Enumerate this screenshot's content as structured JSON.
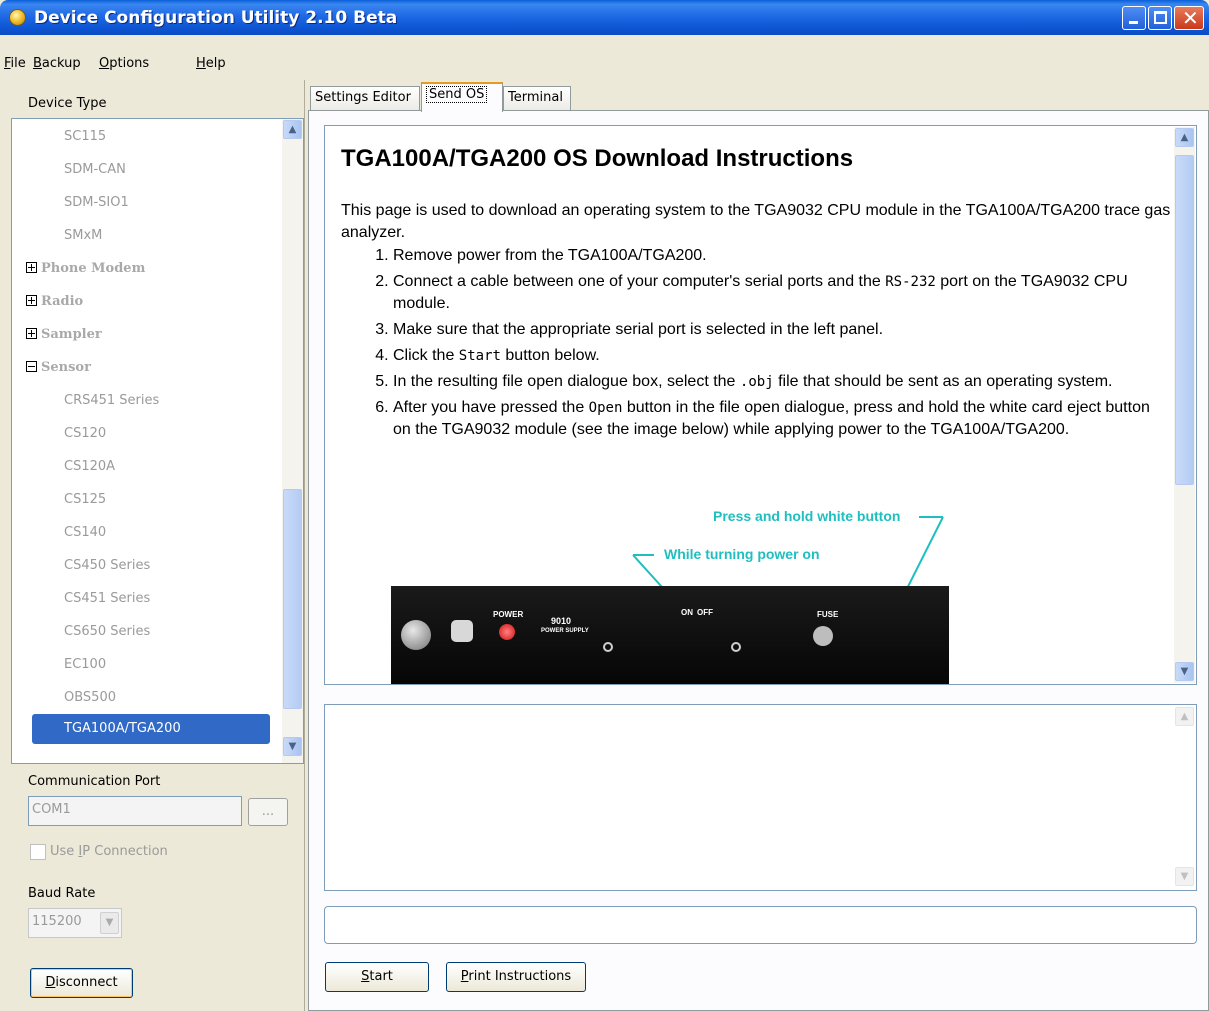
{
  "window": {
    "title": "Device Configuration Utility 2.10 Beta"
  },
  "menu": [
    "File",
    "Backup",
    "Options",
    "Help"
  ],
  "left_panel": {
    "device_type_label": "Device Type",
    "tree": [
      {
        "label": "SC115",
        "type": "leaf"
      },
      {
        "label": "SDM-CAN",
        "type": "leaf"
      },
      {
        "label": "SDM-SIO1",
        "type": "leaf"
      },
      {
        "label": "SMxM",
        "type": "leaf"
      },
      {
        "label": "Phone Modem",
        "type": "group",
        "expanded": false
      },
      {
        "label": "Radio",
        "type": "group",
        "expanded": false
      },
      {
        "label": "Sampler",
        "type": "group",
        "expanded": false
      },
      {
        "label": "Sensor",
        "type": "group",
        "expanded": true
      },
      {
        "label": "CRS451 Series",
        "type": "leaf"
      },
      {
        "label": "CS120",
        "type": "leaf"
      },
      {
        "label": "CS120A",
        "type": "leaf"
      },
      {
        "label": "CS125",
        "type": "leaf"
      },
      {
        "label": "CS140",
        "type": "leaf"
      },
      {
        "label": "CS450 Series",
        "type": "leaf"
      },
      {
        "label": "CS451 Series",
        "type": "leaf"
      },
      {
        "label": "CS650 Series",
        "type": "leaf"
      },
      {
        "label": "EC100",
        "type": "leaf"
      },
      {
        "label": "OBS500",
        "type": "leaf"
      },
      {
        "label": "TGA100A/TGA200",
        "type": "leaf",
        "selected": true
      }
    ],
    "comm_port_label": "Communication Port",
    "comm_port_value": "COM1",
    "browse_label": "...",
    "use_ip_label": "Use IP Connection",
    "use_ip_checked": false,
    "baud_rate_label": "Baud Rate",
    "baud_rate_value": "115200",
    "disconnect_label": "Disconnect"
  },
  "tabs": [
    {
      "label": "Settings Editor",
      "active": false
    },
    {
      "label": "Send OS",
      "active": true
    },
    {
      "label": "Terminal",
      "active": false
    }
  ],
  "instructions": {
    "title": "TGA100A/TGA200 OS Download Instructions",
    "intro": "This page is used to download an operating system to the TGA9032 CPU module in the TGA100A/TGA200 trace gas analyzer.",
    "steps": [
      {
        "pre": "Remove power from the TGA100A/TGA200.",
        "code": "",
        "post": ""
      },
      {
        "pre": "Connect a cable between one of your computer's serial ports and the ",
        "code": "RS-232",
        "post": " port on the TGA9032 CPU module."
      },
      {
        "pre": "Make sure that the appropriate serial port is selected in the left panel.",
        "code": "",
        "post": ""
      },
      {
        "pre": "Click the ",
        "code": "Start",
        "post": " button below."
      },
      {
        "pre": "In the resulting file open dialogue box, select the ",
        "code": ".obj",
        "post": " file that should be sent as an operating system."
      },
      {
        "pre": "After you have pressed the ",
        "code": "Open",
        "post": " button in the file open dialogue, press and hold the white card eject button on the TGA9032 module (see the image below) while applying power to the TGA100A/TGA200."
      }
    ],
    "figure": {
      "callout_1": "Press and hold white button",
      "callout_2": "While turning power on",
      "panel_power": "POWER",
      "panel_model": "9010",
      "panel_supply": "POWER SUPPLY",
      "panel_on": "ON",
      "panel_off": "OFF",
      "panel_fuse": "FUSE",
      "accent_color": "#1fbfc0"
    }
  },
  "buttons": {
    "start": "Start",
    "print": "Print Instructions"
  },
  "colors": {
    "selection": "#3169c6",
    "titlebar": "#0a5fd8",
    "tab_highlight": "#e69b1e"
  }
}
